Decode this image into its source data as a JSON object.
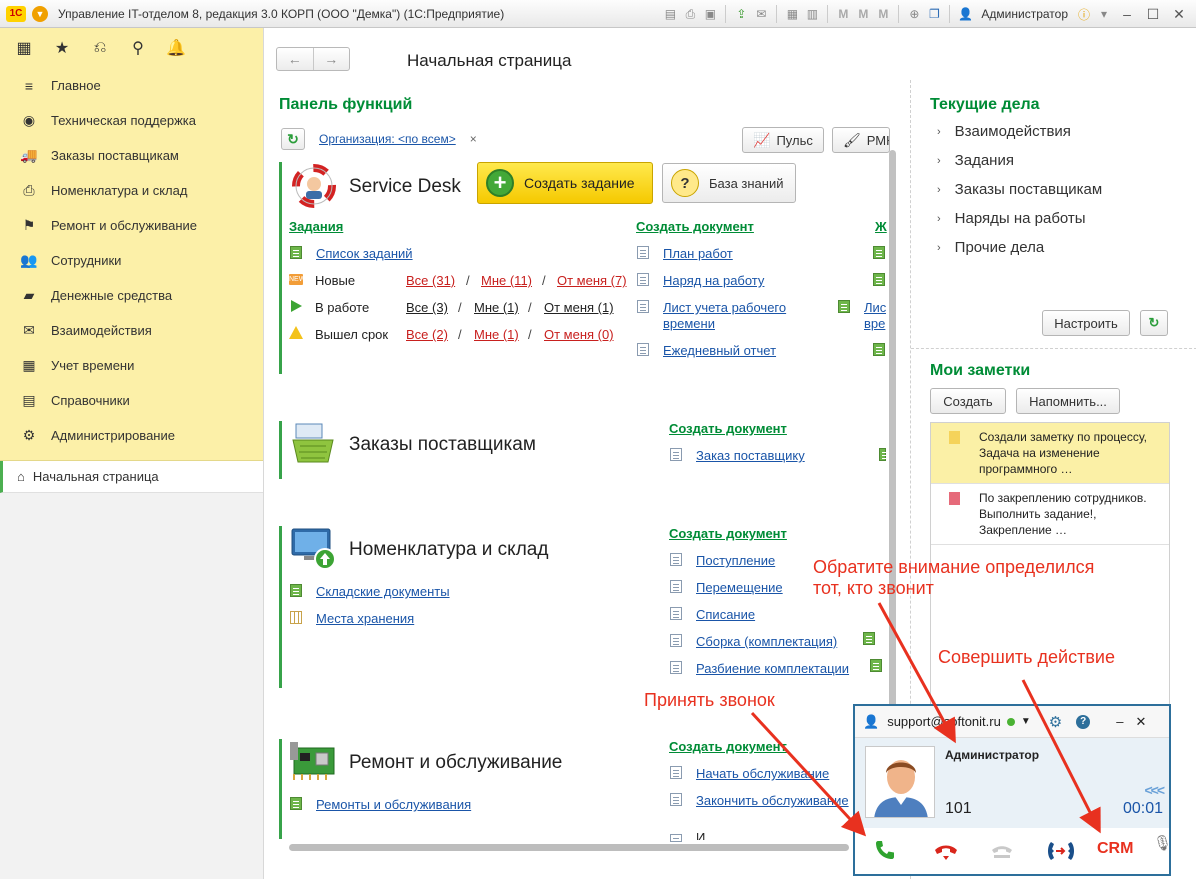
{
  "window": {
    "title": "Управление IT-отделом 8, редакция 3.0 КОРП (ООО \"Демка\")  (1С:Предприятие)",
    "logo": "1С",
    "user": "Администратор"
  },
  "sidebar": {
    "items": [
      {
        "label": "Главное",
        "icon": "menu-icon"
      },
      {
        "label": "Техническая поддержка",
        "icon": "support-icon"
      },
      {
        "label": "Заказы поставщикам",
        "icon": "truck-icon"
      },
      {
        "label": "Номенклатура и склад",
        "icon": "printer-icon"
      },
      {
        "label": "Ремонт и обслуживание",
        "icon": "flag-icon"
      },
      {
        "label": "Сотрудники",
        "icon": "people-icon"
      },
      {
        "label": "Денежные средства",
        "icon": "money-icon"
      },
      {
        "label": "Взаимодействия",
        "icon": "envelope-icon"
      },
      {
        "label": "Учет времени",
        "icon": "calendar-icon"
      },
      {
        "label": "Справочники",
        "icon": "book-icon"
      },
      {
        "label": "Администрирование",
        "icon": "gear-icon"
      }
    ],
    "home": "Начальная страница"
  },
  "main": {
    "page_title": "Начальная страница",
    "panel_title": "Панель функций",
    "org_filter": "Организация: <по всем>",
    "org_clear": "×",
    "pulse_btn": "Пульс",
    "rmk_btn": "РМК",
    "service_desk": {
      "title": "Service Desk",
      "create_task": "Создать задание",
      "knowledge_base": "База знаний",
      "tasks_group": "Задания",
      "task_list": "Список заданий",
      "rows": [
        {
          "label": "Новые",
          "all": "Все (31)",
          "mine": "Мне (11)",
          "from_me": "От меня (7)"
        },
        {
          "label": "В работе",
          "all": "Все (3)",
          "mine": "Мне (1)",
          "from_me": "От меня (1)"
        },
        {
          "label": "Вышел срок",
          "all": "Все (2)",
          "mine": "Мне (1)",
          "from_me": "От меня (0)"
        }
      ],
      "sep": "/",
      "create_doc_group": "Создать документ",
      "docs": [
        "План работ",
        "Наряд на работу",
        "Лист учета рабочего",
        "времени",
        "Ежедневный отчет"
      ],
      "third_col_group": "Ж",
      "third_col_link": "Лис",
      "third_col_link2": "вре"
    },
    "supplier_orders": {
      "title": "Заказы поставщикам",
      "create_doc_group": "Создать документ",
      "docs": [
        "Заказ поставщику"
      ]
    },
    "nomenclature": {
      "title": "Номенклатура и склад",
      "links": [
        "Складские документы",
        "Места хранения"
      ],
      "create_doc_group": "Создать документ",
      "docs": [
        "Поступление",
        "Перемещение",
        "Списание",
        "Сборка (комплектация)",
        "Разбиение комплектации"
      ]
    },
    "repair": {
      "title": "Ремонт и обслуживание",
      "links": [
        "Ремонты и обслуживания"
      ],
      "create_doc_group": "Создать документ",
      "docs": [
        "Начать обслуживание",
        "Закончить обслуживание",
        "И"
      ]
    }
  },
  "right": {
    "current_title": "Текущие дела",
    "current_items": [
      "Взаимодействия",
      "Задания",
      "Заказы поставщикам",
      "Наряды на работы",
      "Прочие дела"
    ],
    "setup_btn": "Настроить",
    "notes_title": "Мои заметки",
    "create_btn": "Создать",
    "remind_btn": "Напомнить...",
    "notes": [
      {
        "text": "Создали заметку по процессу, Задача на изменение программного …",
        "color": "#f5d35a"
      },
      {
        "text": "По закреплению сотрудников. Выполнить задание!, Закрепление …",
        "color": "#e66a7a"
      }
    ]
  },
  "annotations": {
    "caller": "Обратите внимание определился\nтот, кто звонит",
    "action": "Совершить действие",
    "accept": "Принять звонок"
  },
  "phone": {
    "account": "support@softonit.ru",
    "caller_name": "Администратор",
    "number": "101",
    "timer": "00:01",
    "crm": "CRM",
    "status_color": "#4ab233"
  }
}
